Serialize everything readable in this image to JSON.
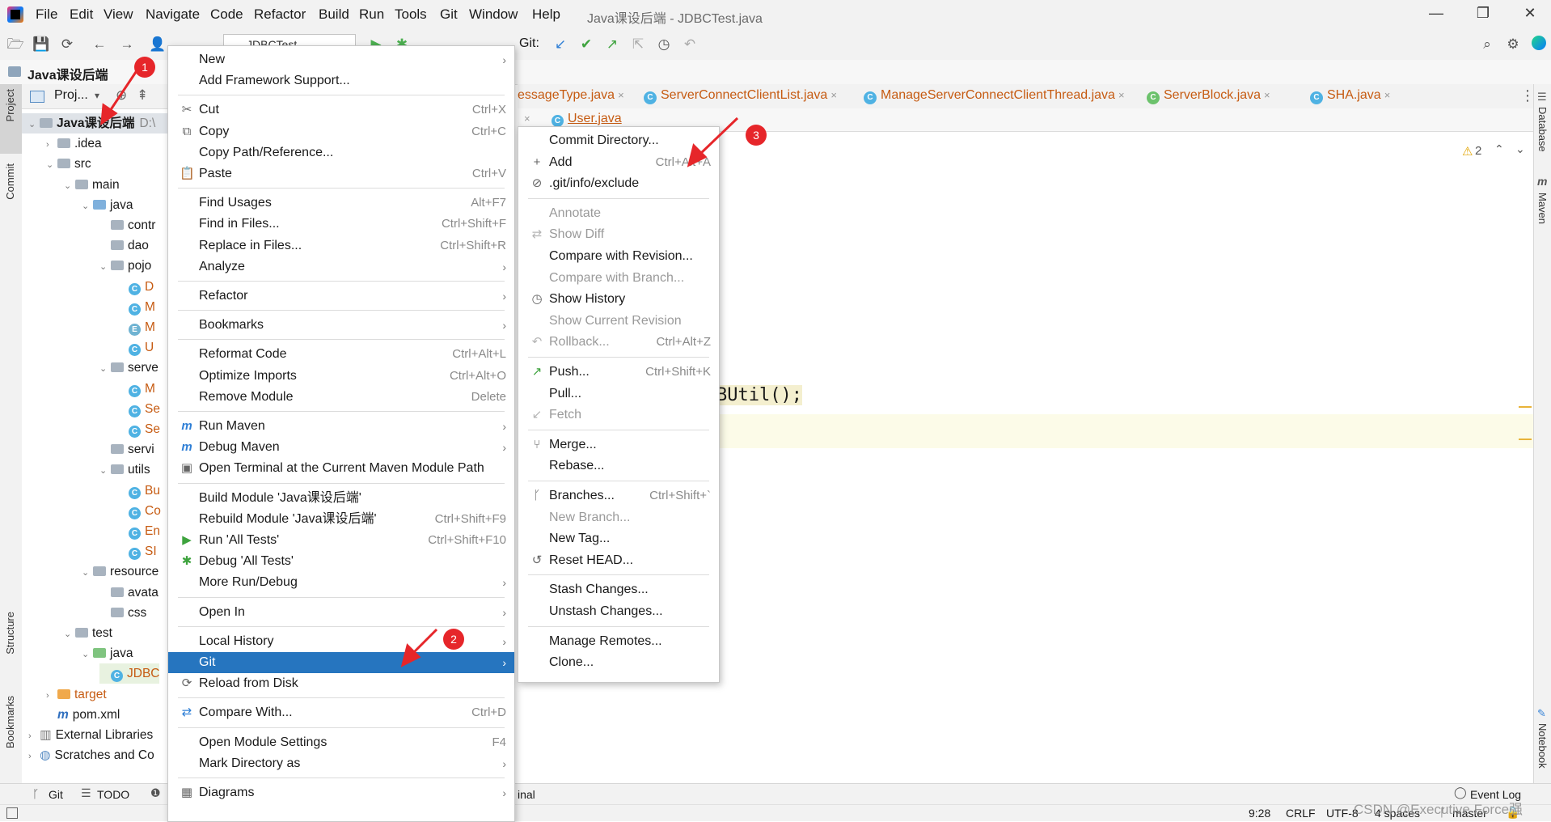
{
  "menubar": [
    "File",
    "Edit",
    "View",
    "Navigate",
    "Code",
    "Refactor",
    "Build",
    "Run",
    "Tools",
    "Git",
    "Window",
    "Help"
  ],
  "window_title": "Java课设后端 - JDBCTest.java",
  "toolbar": {
    "run_config": "JDBCTest",
    "git_label": "Git:"
  },
  "navbar": {
    "project": "Java课设后端"
  },
  "left_strip": {
    "project": "Project",
    "commit": "Commit",
    "structure": "Structure",
    "bookmarks": "Bookmarks"
  },
  "right_strip": {
    "database": "Database",
    "maven": "Maven",
    "notebook": "Notebook"
  },
  "project_panel": {
    "header": "Proj...",
    "tree": [
      {
        "label": "Java课设后端",
        "suffix": "D:\\",
        "indent": 0,
        "type": "module",
        "arrow": "v",
        "bold": true
      },
      {
        "label": ".idea",
        "indent": 1,
        "type": "folder",
        "arrow": ">"
      },
      {
        "label": "src",
        "indent": 1,
        "type": "folder",
        "arrow": "v"
      },
      {
        "label": "main",
        "indent": 2,
        "type": "folder",
        "arrow": "v"
      },
      {
        "label": "java",
        "indent": 3,
        "type": "folder-blue",
        "arrow": "v"
      },
      {
        "label": "contr",
        "indent": 4,
        "type": "folder",
        "arrow": ""
      },
      {
        "label": "dao",
        "indent": 4,
        "type": "folder",
        "arrow": ""
      },
      {
        "label": "pojo",
        "indent": 4,
        "type": "folder",
        "arrow": "v"
      },
      {
        "label": "D",
        "indent": 5,
        "type": "class",
        "arrow": "",
        "color": "#c65b12"
      },
      {
        "label": "M",
        "indent": 5,
        "type": "class",
        "arrow": "",
        "color": "#c65b12"
      },
      {
        "label": "M",
        "indent": 5,
        "type": "enum",
        "arrow": "",
        "color": "#c65b12"
      },
      {
        "label": "U",
        "indent": 5,
        "type": "class",
        "arrow": "",
        "color": "#c65b12"
      },
      {
        "label": "serve",
        "indent": 4,
        "type": "folder",
        "arrow": "v"
      },
      {
        "label": "M",
        "indent": 5,
        "type": "class",
        "arrow": "",
        "color": "#c65b12"
      },
      {
        "label": "Se",
        "indent": 5,
        "type": "class",
        "arrow": "",
        "color": "#c65b12"
      },
      {
        "label": "Se",
        "indent": 5,
        "type": "class",
        "arrow": "",
        "color": "#c65b12"
      },
      {
        "label": "servi",
        "indent": 4,
        "type": "folder",
        "arrow": ""
      },
      {
        "label": "utils",
        "indent": 4,
        "type": "folder",
        "arrow": "v"
      },
      {
        "label": "Bu",
        "indent": 5,
        "type": "class",
        "arrow": "",
        "color": "#c65b12"
      },
      {
        "label": "Co",
        "indent": 5,
        "type": "class",
        "arrow": "",
        "color": "#c65b12"
      },
      {
        "label": "En",
        "indent": 5,
        "type": "class",
        "arrow": "",
        "color": "#c65b12"
      },
      {
        "label": "SI",
        "indent": 5,
        "type": "class",
        "arrow": "",
        "color": "#c65b12"
      },
      {
        "label": "resource",
        "indent": 3,
        "type": "folder",
        "arrow": "v"
      },
      {
        "label": "avata",
        "indent": 4,
        "type": "folder",
        "arrow": ""
      },
      {
        "label": "css",
        "indent": 4,
        "type": "folder",
        "arrow": ""
      },
      {
        "label": "test",
        "indent": 2,
        "type": "folder",
        "arrow": "v"
      },
      {
        "label": "java",
        "indent": 3,
        "type": "folder-green",
        "arrow": "v"
      },
      {
        "label": "JDBC",
        "indent": 4,
        "type": "class",
        "arrow": "",
        "color": "#c65b12"
      },
      {
        "label": "target",
        "indent": 1,
        "type": "folder-orange",
        "arrow": ">",
        "color": "#c65b12"
      },
      {
        "label": "pom.xml",
        "indent": 1,
        "type": "maven",
        "arrow": ""
      },
      {
        "label": "External Libraries",
        "indent": 0,
        "type": "lib",
        "arrow": ">"
      },
      {
        "label": "Scratches and Co",
        "indent": 0,
        "type": "scratch",
        "arrow": ">"
      }
    ]
  },
  "editor_tabs": [
    {
      "label": "essageType.java",
      "color": "#c65b12"
    },
    {
      "label": "ServerConnectClientList.java",
      "color": "#c65b12"
    },
    {
      "label": "ManageServerConnectClientThread.java",
      "color": "#c65b12"
    },
    {
      "label": "ServerBlock.java",
      "color": "#c65b12"
    },
    {
      "label": "SHA.java",
      "color": "#c65b12"
    }
  ],
  "editor_tab_row2": {
    "label": "User.java",
    "color": "#c65b12"
  },
  "editor": {
    "warnings": "2",
    "code_fragment": "BUtil();"
  },
  "context_menu": [
    {
      "label": "New",
      "u": "N",
      "shortcut": "",
      "submenu": true,
      "icon": ""
    },
    {
      "label": "Add Framework Support...",
      "shortcut": "",
      "icon": ""
    },
    {
      "sep": true
    },
    {
      "label": "Cut",
      "u": "t",
      "shortcut": "Ctrl+X",
      "icon": "✂"
    },
    {
      "label": "Copy",
      "u": "C",
      "shortcut": "Ctrl+C",
      "icon": "⧉"
    },
    {
      "label": "Copy Path/Reference...",
      "shortcut": "",
      "icon": ""
    },
    {
      "label": "Paste",
      "u": "P",
      "shortcut": "Ctrl+V",
      "icon": "📋"
    },
    {
      "sep": true
    },
    {
      "label": "Find Usages",
      "u": "U",
      "shortcut": "Alt+F7",
      "icon": ""
    },
    {
      "label": "Find in Files...",
      "shortcut": "Ctrl+Shift+F",
      "icon": ""
    },
    {
      "label": "Replace in Files...",
      "u": "a",
      "shortcut": "Ctrl+Shift+R",
      "icon": ""
    },
    {
      "label": "Analyze",
      "shortcut": "",
      "submenu": true,
      "icon": ""
    },
    {
      "sep": true
    },
    {
      "label": "Refactor",
      "u": "R",
      "shortcut": "",
      "submenu": true,
      "icon": ""
    },
    {
      "sep": true
    },
    {
      "label": "Bookmarks",
      "shortcut": "",
      "submenu": true,
      "icon": ""
    },
    {
      "sep": true
    },
    {
      "label": "Reformat Code",
      "u": "R",
      "shortcut": "Ctrl+Alt+L",
      "icon": ""
    },
    {
      "label": "Optimize Imports",
      "u": "z",
      "shortcut": "Ctrl+Alt+O",
      "icon": ""
    },
    {
      "label": "Remove Module",
      "shortcut": "Delete",
      "icon": ""
    },
    {
      "sep": true
    },
    {
      "label": "Run Maven",
      "shortcut": "",
      "submenu": true,
      "icon": "m"
    },
    {
      "label": "Debug Maven",
      "shortcut": "",
      "submenu": true,
      "icon": "m"
    },
    {
      "label": "Open Terminal at the Current Maven Module Path",
      "shortcut": "",
      "icon": "▣"
    },
    {
      "sep": true
    },
    {
      "label": "Build Module 'Java课设后端'",
      "u": "M",
      "shortcut": "",
      "icon": ""
    },
    {
      "label": "Rebuild Module 'Java课设后端'",
      "u": "e",
      "shortcut": "Ctrl+Shift+F9",
      "icon": ""
    },
    {
      "label": "Run 'All Tests'",
      "u": "u",
      "shortcut": "Ctrl+Shift+F10",
      "icon": "▶"
    },
    {
      "label": "Debug 'All Tests'",
      "u": "D",
      "shortcut": "",
      "icon": "✱"
    },
    {
      "label": "More Run/Debug",
      "shortcut": "",
      "submenu": true,
      "icon": ""
    },
    {
      "sep": true
    },
    {
      "label": "Open In",
      "shortcut": "",
      "submenu": true,
      "icon": ""
    },
    {
      "sep": true
    },
    {
      "label": "Local History",
      "u": "H",
      "shortcut": "",
      "submenu": true,
      "icon": ""
    },
    {
      "label": "Git",
      "u": "G",
      "shortcut": "",
      "submenu": true,
      "icon": "",
      "selected": true
    },
    {
      "label": "Reload from Disk",
      "shortcut": "",
      "icon": "⟳"
    },
    {
      "sep": true
    },
    {
      "label": "Compare With...",
      "u": "h",
      "shortcut": "Ctrl+D",
      "icon": "⇄"
    },
    {
      "sep": true
    },
    {
      "label": "Open Module Settings",
      "shortcut": "F4",
      "icon": ""
    },
    {
      "label": "Mark Directory as",
      "shortcut": "",
      "submenu": true,
      "icon": ""
    },
    {
      "sep": true
    },
    {
      "label": "Diagrams",
      "shortcut": "",
      "submenu": true,
      "icon": "▦"
    }
  ],
  "git_submenu": [
    {
      "label": "Commit Directory...",
      "shortcut": "",
      "icon": ""
    },
    {
      "label": "Add",
      "shortcut": "Ctrl+Alt+A",
      "icon": "+"
    },
    {
      "label": ".git/info/exclude",
      "shortcut": "",
      "icon": "⊘"
    },
    {
      "sep": true
    },
    {
      "label": "Annotate",
      "shortcut": "",
      "icon": "",
      "disabled": true
    },
    {
      "label": "Show Diff",
      "shortcut": "",
      "icon": "⇄",
      "disabled": true
    },
    {
      "label": "Compare with Revision...",
      "shortcut": "",
      "icon": ""
    },
    {
      "label": "Compare with Branch...",
      "shortcut": "",
      "icon": "",
      "disabled": true
    },
    {
      "label": "Show History",
      "shortcut": "",
      "icon": "◷"
    },
    {
      "label": "Show Current Revision",
      "shortcut": "",
      "icon": "",
      "disabled": true
    },
    {
      "label": "Rollback...",
      "shortcut": "Ctrl+Alt+Z",
      "icon": "↶",
      "disabled": true
    },
    {
      "sep": true
    },
    {
      "label": "Push...",
      "shortcut": "Ctrl+Shift+K",
      "icon": "↗"
    },
    {
      "label": "Pull...",
      "shortcut": "",
      "icon": ""
    },
    {
      "label": "Fetch",
      "shortcut": "",
      "icon": "↙",
      "disabled": true
    },
    {
      "sep": true
    },
    {
      "label": "Merge...",
      "shortcut": "",
      "icon": "⑂"
    },
    {
      "label": "Rebase...",
      "shortcut": "",
      "icon": ""
    },
    {
      "sep": true
    },
    {
      "label": "Branches...",
      "shortcut": "Ctrl+Shift+`",
      "icon": "ᚴ"
    },
    {
      "label": "New Branch...",
      "shortcut": "",
      "icon": "",
      "disabled": true
    },
    {
      "label": "New Tag...",
      "shortcut": "",
      "icon": ""
    },
    {
      "label": "Reset HEAD...",
      "shortcut": "",
      "icon": "↺"
    },
    {
      "sep": true
    },
    {
      "label": "Stash Changes...",
      "shortcut": "",
      "icon": ""
    },
    {
      "label": "Unstash Changes...",
      "shortcut": "",
      "icon": ""
    },
    {
      "sep": true
    },
    {
      "label": "Manage Remotes...",
      "shortcut": "",
      "icon": ""
    },
    {
      "label": "Clone...",
      "shortcut": "",
      "icon": ""
    }
  ],
  "bottom_bar": {
    "git": "Git",
    "todo": "TODO",
    "terminal": "inal",
    "event_log": "Event Log"
  },
  "status_bar": {
    "position": "9:28",
    "line_sep": "CRLF",
    "encoding": "UTF-8",
    "indent": "4 spaces",
    "branch": "master"
  },
  "watermark": "CSDN @Executive Force强",
  "badges": [
    "1",
    "2",
    "3"
  ],
  "colors": {
    "selection": "#2675bf",
    "badge": "#e6262a",
    "orange_file": "#c65b12"
  }
}
